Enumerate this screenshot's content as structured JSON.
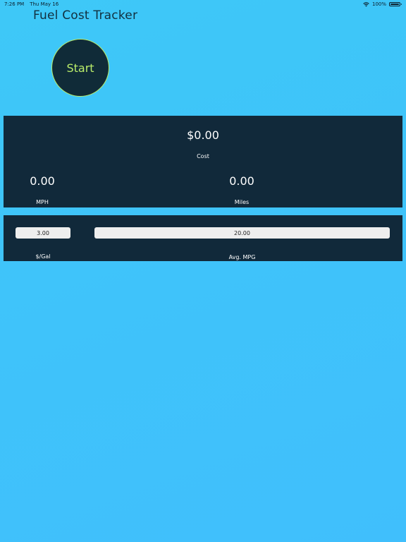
{
  "status_bar": {
    "time": "7:26 PM",
    "date": "Thu May 16",
    "battery": "100%",
    "battery_level": 1.0
  },
  "app": {
    "title": "Fuel Cost Tracker"
  },
  "start_button": {
    "label": "Start",
    "accent_color": "#b9ec6a"
  },
  "stats": {
    "cost_value": "$0.00",
    "cost_label": "Cost",
    "mph_value": "0.00",
    "mph_label": "MPH",
    "miles_value": "0.00",
    "miles_label": "Miles"
  },
  "settings": {
    "price_value": "3.00",
    "price_label": "$/Gal",
    "mpg_value": "20.00",
    "mpg_label": "Avg. MPG"
  },
  "colors": {
    "background": "#3fc3fa",
    "panel": "#11293a",
    "title_text": "#12303f"
  }
}
